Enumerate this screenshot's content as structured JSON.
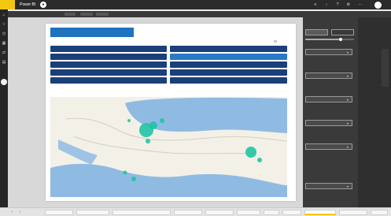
{
  "app": {
    "brand": "",
    "title": "Power BI",
    "breadcrumb": "",
    "status": ""
  },
  "topbar_icons": [
    {
      "name": "notification-icon",
      "glyph": "≡"
    },
    {
      "name": "download-icon",
      "glyph": "↓"
    },
    {
      "name": "help-icon",
      "glyph": "?"
    },
    {
      "name": "settings-icon",
      "glyph": "⚙"
    },
    {
      "name": "more-icon",
      "glyph": "⋯"
    }
  ],
  "ribbon": {
    "items": [
      "",
      "",
      "",
      "",
      "",
      "",
      "",
      "",
      ""
    ]
  },
  "left_rail": [
    {
      "name": "home-icon",
      "glyph": "⌂"
    },
    {
      "name": "favorites-icon",
      "glyph": "☆"
    },
    {
      "name": "recent-icon",
      "glyph": "◷"
    },
    {
      "name": "apps-icon",
      "glyph": "▦"
    },
    {
      "name": "shared-icon",
      "glyph": "⇄"
    },
    {
      "name": "workspace-icon",
      "glyph": "▤"
    }
  ],
  "report": {
    "title": "",
    "table": [
      {
        "label": "",
        "value": ""
      },
      {
        "label": "",
        "value": ""
      },
      {
        "label": "",
        "value": ""
      },
      {
        "label": "",
        "value": ""
      },
      {
        "label": "",
        "value": ""
      }
    ]
  },
  "map": {
    "logo": "",
    "credit": ""
  },
  "filter_panel": {
    "title": "",
    "segments": [
      "",
      ""
    ],
    "slider_value": 0.72,
    "dropdowns": [
      {
        "label": "",
        "value": ""
      },
      {
        "label": "",
        "value": ""
      },
      {
        "label": "",
        "value": ""
      },
      {
        "label": "",
        "value": ""
      },
      {
        "label": "",
        "value": ""
      },
      {
        "label": "",
        "value": ""
      }
    ]
  },
  "pages": {
    "tabs": [
      "",
      "",
      "",
      "",
      "",
      "",
      "",
      "",
      "",
      "",
      ""
    ],
    "active_index": 8
  },
  "colors": {
    "accent": "#f2c811",
    "table_dark": "#1b3f7a",
    "table_light": "#2a79c6",
    "bubble": "#1fc4a4",
    "water": "#8fbbe3",
    "land": "#f3f0e8"
  }
}
